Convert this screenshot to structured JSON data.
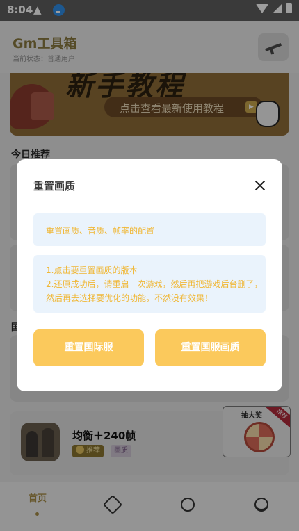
{
  "status_bar": {
    "time": "8:04"
  },
  "header": {
    "title": "Gm工具箱",
    "subtitle": "当前状态：普通用户"
  },
  "banner": {
    "headline": "新手教程",
    "cta_label": "点击查看最新使用教程"
  },
  "sections": {
    "today_recommend": "今日推荐",
    "side_label": "国"
  },
  "game_card": {
    "title": "均衡＋240帧",
    "tags": [
      "推荐",
      "画质"
    ]
  },
  "lottery": {
    "title": "抽大奖",
    "ribbon": "推荐"
  },
  "bottom_nav": {
    "home": "首页",
    "items": [
      "tools-icon",
      "stats-icon",
      "profile-icon"
    ]
  },
  "dialog": {
    "title": "重置画质",
    "info": "重置画质、音质、帧率的配置",
    "steps": [
      "1.点击要重置画质的版本",
      "2.还原成功后，请重启一次游戏，然后再把游戏后台删了，然后再去选择要优化的功能，不然没有效果！"
    ],
    "buttons": {
      "international": "重置国际服",
      "china": "重置国服画质"
    }
  },
  "colors": {
    "accent": "#fbc95c",
    "accent_text": "#f0b735",
    "info_bg": "#eaf3fc",
    "overlay": "rgba(0,0,0,0.38)"
  }
}
